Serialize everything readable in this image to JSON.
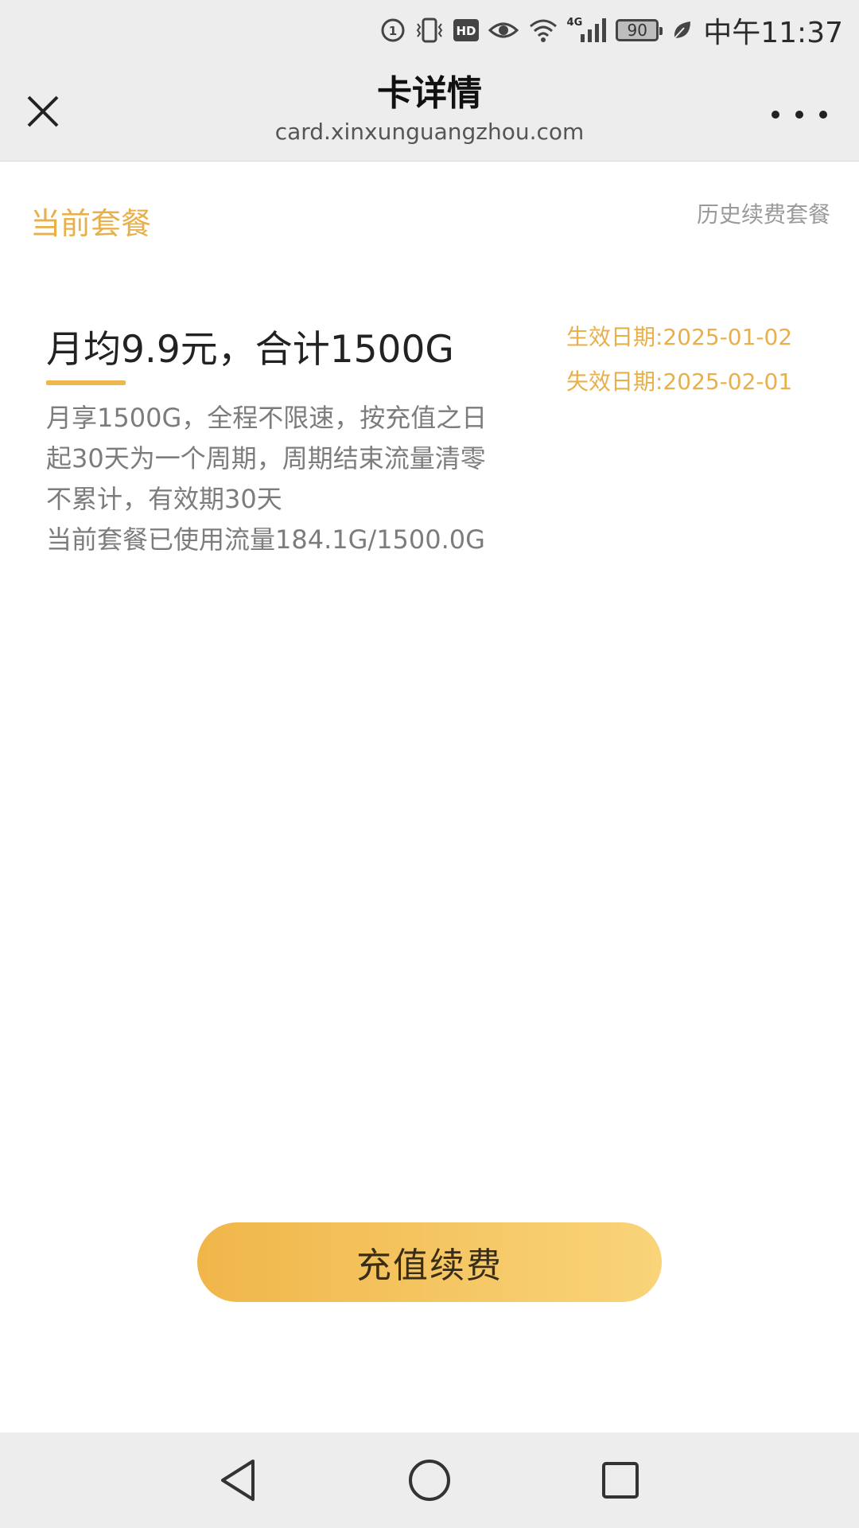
{
  "status_bar": {
    "time": "中午11:37",
    "battery_level": "90",
    "network": "4G",
    "icons": [
      "data-saver-icon",
      "vibrate-icon",
      "hd-icon",
      "eye-comfort-icon",
      "wifi-icon",
      "signal-icon",
      "battery-icon",
      "leaf-icon"
    ]
  },
  "header": {
    "title": "卡详情",
    "url": "card.xinxunguangzhou.com",
    "close_icon": "close-icon",
    "more_icon": "more-icon"
  },
  "tabs": {
    "current": "当前套餐",
    "history": "历史续费套餐"
  },
  "plan": {
    "title": "月均9.9元，合计1500G",
    "description_lines": [
      "月享1500G，全程不限速，按充值之日",
      "起30天为一个周期，周期结束流量清零",
      "不累计，有效期30天",
      "当前套餐已使用流量184.1G/1500.0G"
    ],
    "effective_date": "生效日期:2025-01-02",
    "expiry_date": "失效日期:2025-02-01"
  },
  "actions": {
    "recharge_label": "充值续费"
  },
  "nav": {
    "back_icon": "back-icon",
    "home_icon": "home-icon",
    "recents_icon": "recents-icon"
  },
  "colors": {
    "accent": "#e8b04a",
    "button_gradient_start": "#f0b64a",
    "button_gradient_end": "#f9d479",
    "bar_background": "#ededed"
  }
}
